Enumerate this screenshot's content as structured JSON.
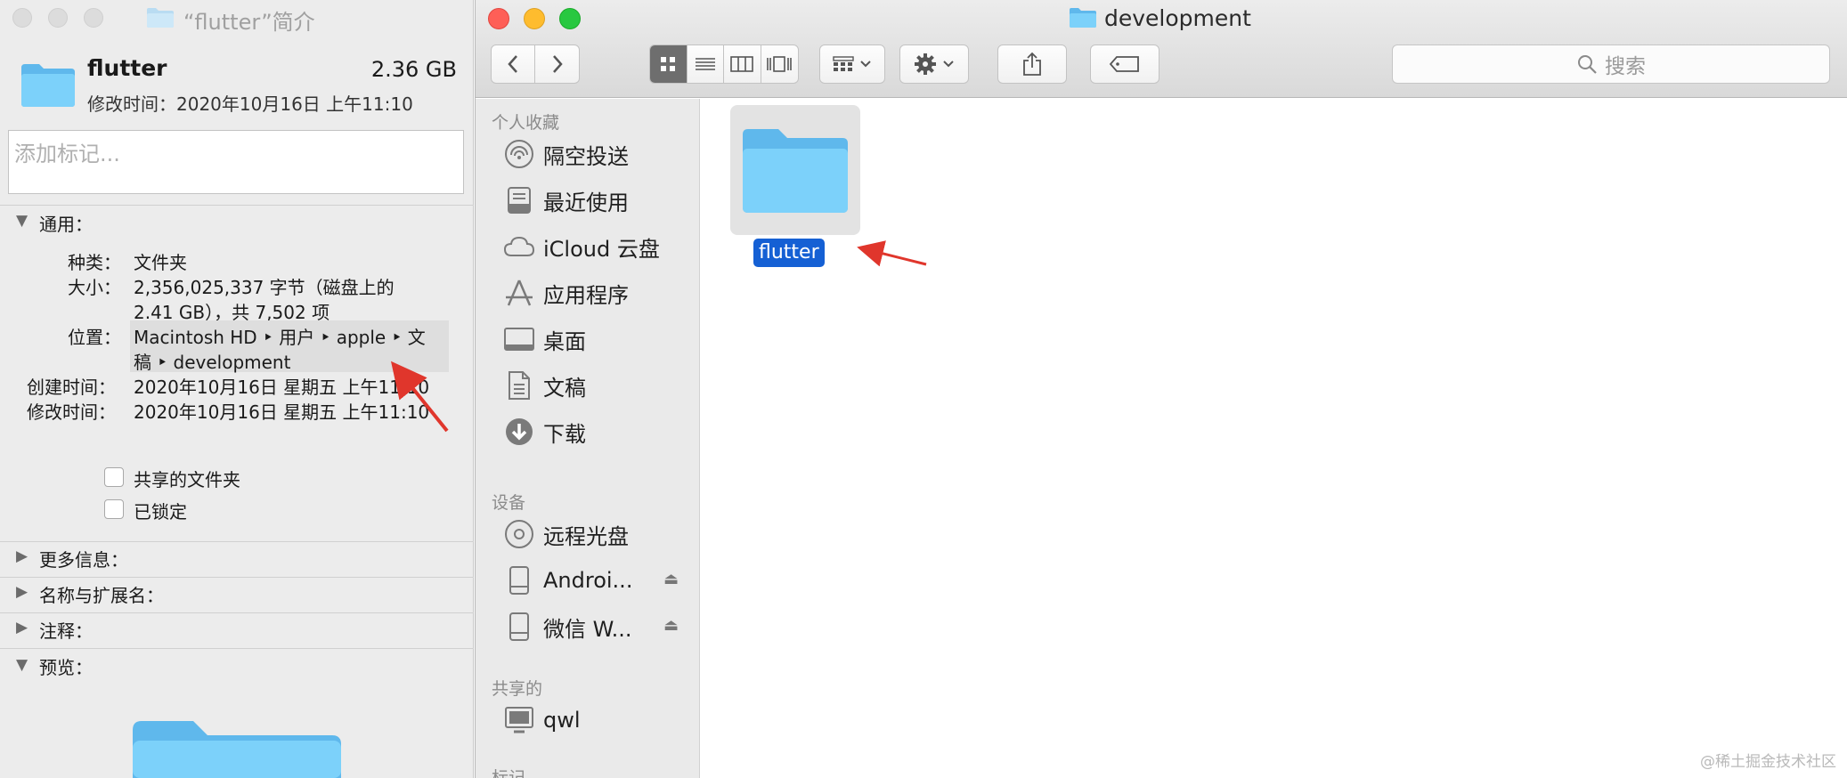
{
  "info_window": {
    "title": "“flutter”简介",
    "name": "flutter",
    "size": "2.36 GB",
    "modified": "修改时间：2020年10月16日 上午11:10",
    "tag_placeholder": "添加标记...",
    "general": {
      "label": "通用：",
      "kind_key": "种类：",
      "kind_val": "文件夹",
      "size_key": "大小：",
      "size_val_1": "2,356,025,337 字节（磁盘上的",
      "size_val_2": "2.41 GB），共 7,502 项",
      "where_key": "位置：",
      "where_val_1": "Macintosh HD ‣ 用户 ‣ apple ‣ 文",
      "where_val_2": "稿 ‣ development",
      "created_key": "创建时间：",
      "created_val": "2020年10月16日 星期五 上午11:10",
      "modified_key": "修改时间：",
      "modified_val": "2020年10月16日 星期五 上午11:10"
    },
    "checkboxes": [
      {
        "label": "共享的文件夹",
        "checked": false
      },
      {
        "label": "已锁定",
        "checked": false
      }
    ],
    "sections": [
      "更多信息：",
      "名称与扩展名：",
      "注释：",
      "预览："
    ]
  },
  "finder": {
    "title": "development",
    "search_placeholder": "搜索",
    "sidebar": {
      "favorites_label": "个人收藏",
      "favorites": [
        {
          "label": "隔空投送",
          "icon": "airdrop-icon"
        },
        {
          "label": "最近使用",
          "icon": "recents-icon"
        },
        {
          "label": "iCloud 云盘",
          "icon": "cloud-icon"
        },
        {
          "label": "应用程序",
          "icon": "applications-icon"
        },
        {
          "label": "桌面",
          "icon": "desktop-icon"
        },
        {
          "label": "文稿",
          "icon": "documents-icon"
        },
        {
          "label": "下载",
          "icon": "downloads-icon"
        }
      ],
      "devices_label": "设备",
      "devices": [
        {
          "label": "远程光盘",
          "icon": "disc-icon"
        },
        {
          "label": "Androi...",
          "icon": "drive-icon",
          "eject": true
        },
        {
          "label": "微信 W...",
          "icon": "drive-icon",
          "eject": true
        }
      ],
      "shared_label": "共享的",
      "shared": [
        {
          "label": "qwl",
          "icon": "computer-icon"
        }
      ],
      "partial_label": "标记"
    },
    "items": [
      {
        "name": "flutter",
        "selected": true
      }
    ]
  },
  "watermark": "@稀土掘金技术社区",
  "colors": {
    "folder": "#6cc7f6",
    "selection": "#1560d4",
    "annotation_arrow": "#e0362c"
  }
}
